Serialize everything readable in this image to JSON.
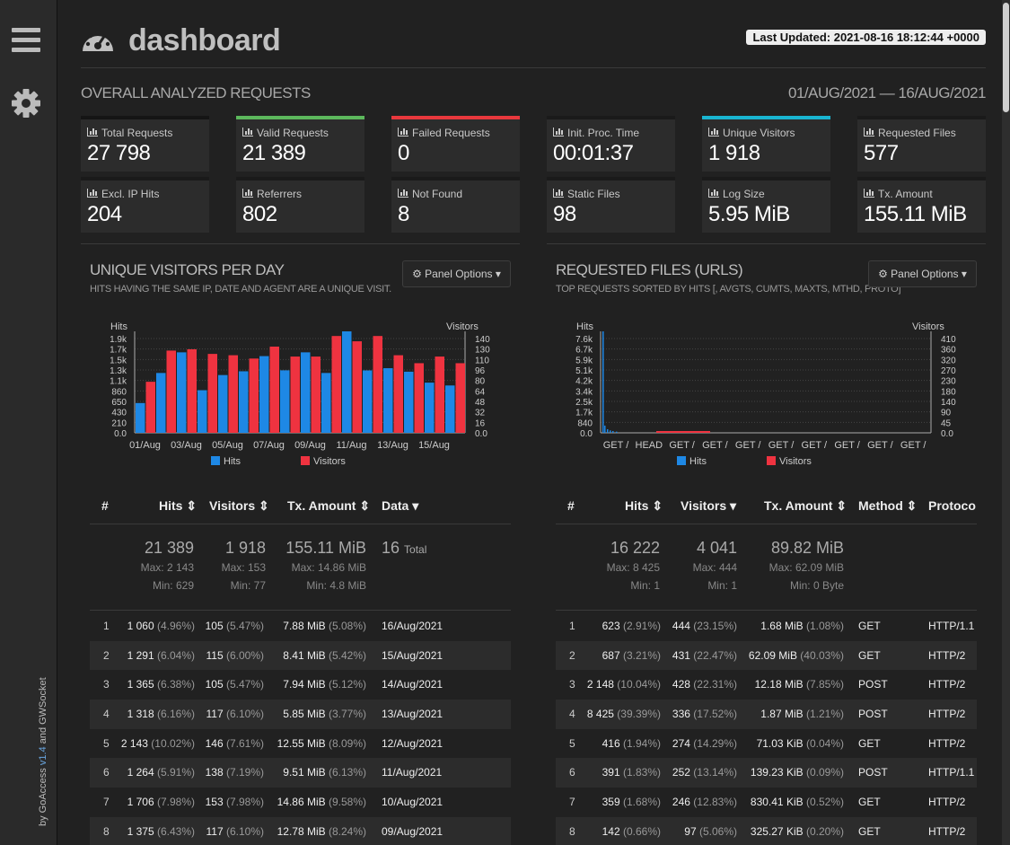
{
  "header": {
    "title": "dashboard",
    "last_updated": "Last Updated: 2021-08-16 18:12:44 +0000"
  },
  "sidebar": {
    "credits_prefix": "by GoAccess ",
    "version": "v1.4",
    "credits_suffix": " and GWSocket"
  },
  "overall": {
    "title": "OVERALL ANALYZED REQUESTS",
    "range": "01/AUG/2021 — 16/AUG/2021",
    "cards": [
      {
        "label": "Total Requests",
        "value": "27 798",
        "color": "#151515"
      },
      {
        "label": "Valid Requests",
        "value": "21 389",
        "color": "#5cb85c"
      },
      {
        "label": "Failed Requests",
        "value": "0",
        "color": "#e8383d"
      },
      {
        "label": "Init. Proc. Time",
        "value": "00:01:37",
        "color": "#1a1a1a"
      },
      {
        "label": "Unique Visitors",
        "value": "1 918",
        "color": "#19b5d1"
      },
      {
        "label": "Requested Files",
        "value": "577",
        "color": "#1a1a1a"
      },
      {
        "label": "Excl. IP Hits",
        "value": "204",
        "color": "#1a1a1a"
      },
      {
        "label": "Referrers",
        "value": "802",
        "color": "#1a1a1a"
      },
      {
        "label": "Not Found",
        "value": "8",
        "color": "#1a1a1a"
      },
      {
        "label": "Static Files",
        "value": "98",
        "color": "#1a1a1a"
      },
      {
        "label": "Log Size",
        "value": "5.95 MiB",
        "color": "#1a1a1a"
      },
      {
        "label": "Tx. Amount",
        "value": "155.11 MiB",
        "color": "#1a1a1a"
      }
    ]
  },
  "visitors_panel": {
    "title": "UNIQUE VISITORS PER DAY",
    "subtitle": "HITS HAVING THE SAME IP, DATE AND AGENT ARE A UNIQUE VISIT.",
    "options": "Panel Options",
    "columns": [
      "#",
      "Hits",
      "Visitors",
      "Tx. Amount",
      "Data"
    ],
    "summary": {
      "hits": "21 389",
      "hits_max": "Max: 2 143",
      "hits_min": "Min: 629",
      "visitors": "1 918",
      "visitors_max": "Max: 153",
      "visitors_min": "Min: 77",
      "tx": "155.11 MiB",
      "tx_max": "Max: 14.86 MiB",
      "tx_min": "Min: 4.8 MiB",
      "data_count": "16",
      "data_label": "Total"
    },
    "rows": [
      {
        "n": "1",
        "hits": "1 060",
        "hits_pct": "(4.96%)",
        "vis": "105",
        "vis_pct": "(5.47%)",
        "tx": "7.88 MiB",
        "tx_pct": "(5.08%)",
        "data": "16/Aug/2021"
      },
      {
        "n": "2",
        "hits": "1 291",
        "hits_pct": "(6.04%)",
        "vis": "115",
        "vis_pct": "(6.00%)",
        "tx": "8.41 MiB",
        "tx_pct": "(5.42%)",
        "data": "15/Aug/2021"
      },
      {
        "n": "3",
        "hits": "1 365",
        "hits_pct": "(6.38%)",
        "vis": "105",
        "vis_pct": "(5.47%)",
        "tx": "7.94 MiB",
        "tx_pct": "(5.12%)",
        "data": "14/Aug/2021"
      },
      {
        "n": "4",
        "hits": "1 318",
        "hits_pct": "(6.16%)",
        "vis": "117",
        "vis_pct": "(6.10%)",
        "tx": "5.85 MiB",
        "tx_pct": "(3.77%)",
        "data": "13/Aug/2021"
      },
      {
        "n": "5",
        "hits": "2 143",
        "hits_pct": "(10.02%)",
        "vis": "146",
        "vis_pct": "(7.61%)",
        "tx": "12.55 MiB",
        "tx_pct": "(8.09%)",
        "data": "12/Aug/2021"
      },
      {
        "n": "6",
        "hits": "1 264",
        "hits_pct": "(5.91%)",
        "vis": "138",
        "vis_pct": "(7.19%)",
        "tx": "9.51 MiB",
        "tx_pct": "(6.13%)",
        "data": "11/Aug/2021"
      },
      {
        "n": "7",
        "hits": "1 706",
        "hits_pct": "(7.98%)",
        "vis": "153",
        "vis_pct": "(7.98%)",
        "tx": "14.86 MiB",
        "tx_pct": "(9.58%)",
        "data": "10/Aug/2021"
      },
      {
        "n": "8",
        "hits": "1 375",
        "hits_pct": "(6.43%)",
        "vis": "117",
        "vis_pct": "(6.10%)",
        "tx": "12.78 MiB",
        "tx_pct": "(8.24%)",
        "data": "09/Aug/2021"
      }
    ]
  },
  "files_panel": {
    "title": "REQUESTED FILES (URLS)",
    "subtitle": "TOP REQUESTS SORTED BY HITS [, AVGTS, CUMTS, MAXTS, MTHD, PROTO]",
    "options": "Panel Options",
    "columns": [
      "#",
      "Hits",
      "Visitors",
      "Tx. Amount",
      "Method",
      "Protoco"
    ],
    "summary": {
      "hits": "16 222",
      "hits_max": "Max: 8 425",
      "hits_min": "Min: 1",
      "visitors": "4 041",
      "visitors_max": "Max: 444",
      "visitors_min": "Min: 1",
      "tx": "89.82 MiB",
      "tx_max": "Max: 62.09 MiB",
      "tx_min": "Min: 0 Byte"
    },
    "rows": [
      {
        "n": "1",
        "hits": "623",
        "hits_pct": "(2.91%)",
        "vis": "444",
        "vis_pct": "(23.15%)",
        "tx": "1.68 MiB",
        "tx_pct": "(1.08%)",
        "method": "GET",
        "proto": "HTTP/1.1"
      },
      {
        "n": "2",
        "hits": "687",
        "hits_pct": "(3.21%)",
        "vis": "431",
        "vis_pct": "(22.47%)",
        "tx": "62.09 MiB",
        "tx_pct": "(40.03%)",
        "method": "GET",
        "proto": "HTTP/2"
      },
      {
        "n": "3",
        "hits": "2 148",
        "hits_pct": "(10.04%)",
        "vis": "428",
        "vis_pct": "(22.31%)",
        "tx": "12.18 MiB",
        "tx_pct": "(7.85%)",
        "method": "POST",
        "proto": "HTTP/2"
      },
      {
        "n": "4",
        "hits": "8 425",
        "hits_pct": "(39.39%)",
        "vis": "336",
        "vis_pct": "(17.52%)",
        "tx": "1.87 MiB",
        "tx_pct": "(1.21%)",
        "method": "POST",
        "proto": "HTTP/2"
      },
      {
        "n": "5",
        "hits": "416",
        "hits_pct": "(1.94%)",
        "vis": "274",
        "vis_pct": "(14.29%)",
        "tx": "71.03 KiB",
        "tx_pct": "(0.04%)",
        "method": "GET",
        "proto": "HTTP/2"
      },
      {
        "n": "6",
        "hits": "391",
        "hits_pct": "(1.83%)",
        "vis": "252",
        "vis_pct": "(13.14%)",
        "tx": "139.23 KiB",
        "tx_pct": "(0.09%)",
        "method": "POST",
        "proto": "HTTP/1.1"
      },
      {
        "n": "7",
        "hits": "359",
        "hits_pct": "(1.68%)",
        "vis": "246",
        "vis_pct": "(12.83%)",
        "tx": "830.41 KiB",
        "tx_pct": "(0.52%)",
        "method": "GET",
        "proto": "HTTP/2"
      },
      {
        "n": "8",
        "hits": "142",
        "hits_pct": "(0.66%)",
        "vis": "97",
        "vis_pct": "(5.06%)",
        "tx": "325.27 KiB",
        "tx_pct": "(0.20%)",
        "method": "GET",
        "proto": "HTTP/2"
      }
    ]
  },
  "chart_data": [
    {
      "type": "bar",
      "hits_color": "#1e88e5",
      "visitors_color": "#ef3340",
      "ylabel_left": "Hits",
      "ylabel_right": "Visitors",
      "left_ticks": [
        "0.0",
        "210",
        "430",
        "650",
        "860",
        "1.1k",
        "1.3k",
        "1.5k",
        "1.7k",
        "1.9k"
      ],
      "right_ticks": [
        "0.0",
        "16",
        "32",
        "48",
        "64",
        "80",
        "96",
        "110",
        "130",
        "140"
      ],
      "ylim_left": [
        0,
        2143
      ],
      "ylim_right": [
        0,
        153
      ],
      "x_labels": [
        "01/Aug",
        "03/Aug",
        "05/Aug",
        "07/Aug",
        "09/Aug",
        "11/Aug",
        "13/Aug",
        "15/Aug"
      ],
      "series": [
        {
          "name": "Hits",
          "values": [
            629,
            1264,
            1700,
            900,
            1220,
            1300,
            1620,
            1320,
            1700,
            1264,
            2143,
            1318,
            1365,
            1291,
            1060,
            1000
          ]
        },
        {
          "name": "Visitors",
          "values": [
            77,
            124,
            126,
            119,
            117,
            112,
            130,
            115,
            115,
            146,
            138,
            146,
            117,
            105,
            115,
            105
          ]
        }
      ]
    },
    {
      "type": "bar",
      "hits_color": "#1e88e5",
      "visitors_color": "#ef3340",
      "ylabel_left": "Hits",
      "ylabel_right": "Visitors",
      "left_ticks": [
        "0.0",
        "840",
        "1.7k",
        "2.5k",
        "3.4k",
        "4.2k",
        "5.1k",
        "5.9k",
        "6.7k",
        "7.6k"
      ],
      "right_ticks": [
        "0.0",
        "45",
        "90",
        "140",
        "180",
        "230",
        "270",
        "320",
        "360",
        "410"
      ],
      "ylim_left": [
        0,
        8425
      ],
      "ylim_right": [
        0,
        444
      ],
      "x_labels": [
        "GET /",
        "HEAD",
        "GET /",
        "GET /",
        "GET /",
        "GET /",
        "GET /",
        "GET /",
        "GET /",
        "GET /"
      ]
    }
  ]
}
